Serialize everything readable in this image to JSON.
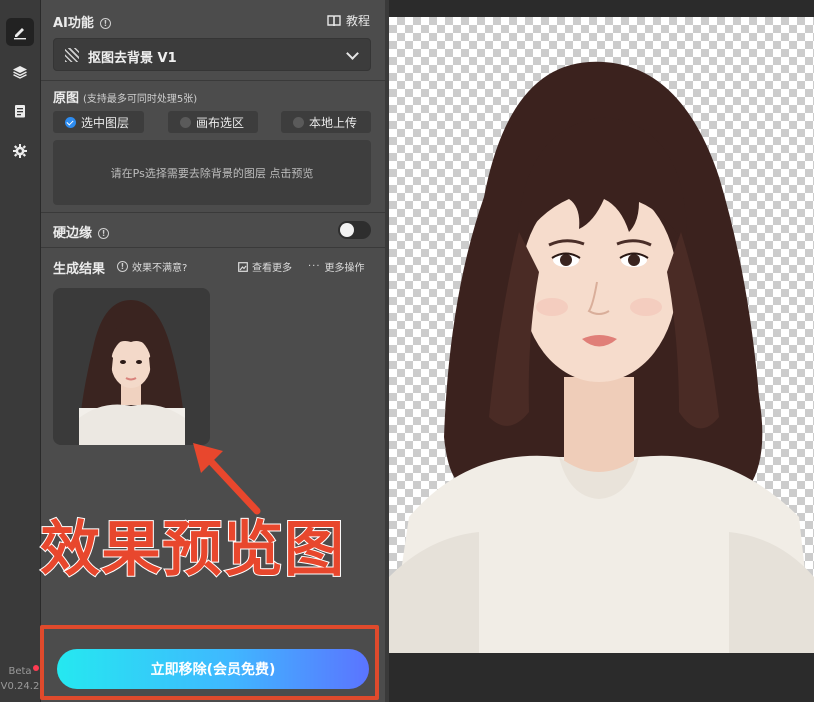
{
  "toolbar": {
    "tools": [
      "edit-icon",
      "layers-icon",
      "clipboard-icon",
      "gear-icon"
    ],
    "beta_label": "Beta",
    "version": "V0.24.2"
  },
  "panel": {
    "ai_section": {
      "title": "AI功能",
      "tutorial_label": "教程",
      "selected_feature": "抠图去背景 V1"
    },
    "source_section": {
      "title": "原图",
      "hint": "(支持最多可同时处理5张)",
      "options": [
        {
          "label": "选中图层",
          "checked": true
        },
        {
          "label": "画布选区",
          "checked": false
        },
        {
          "label": "本地上传",
          "checked": false
        }
      ],
      "dropzone_text": "请在Ps选择需要去除背景的图层 点击预览"
    },
    "hard_edge": {
      "title": "硬边缘",
      "enabled": false
    },
    "result_section": {
      "title": "生成结果",
      "feedback_label": "效果不满意?",
      "view_more_label": "查看更多",
      "more_actions_label": "更多操作"
    },
    "annotation_caption": "效果预览图",
    "cta_label": "立即移除(会员免费)"
  },
  "colors": {
    "accent_blue": "#2d8cf0",
    "annotation_red": "#e04a2c",
    "cta_gradient_start": "#25e8f0",
    "cta_gradient_end": "#5b74ff"
  }
}
